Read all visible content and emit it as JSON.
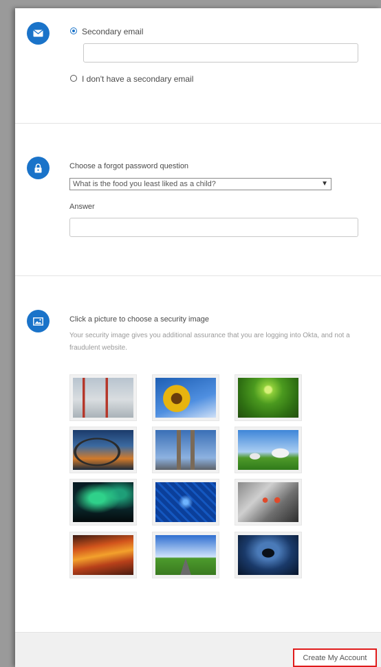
{
  "email": {
    "secondary_label": "Secondary email",
    "secondary_value": "",
    "no_secondary_label": "I don't have a secondary email",
    "selected": "secondary"
  },
  "password_question": {
    "label": "Choose a forgot password question",
    "selected_question": "What is the food you least liked as a child?",
    "answer_label": "Answer",
    "answer_value": ""
  },
  "security_image": {
    "title": "Click a picture to choose a security image",
    "description": "Your security image gives you additional assurance that you are logging into Okta, and not a fraudulent website.",
    "images": [
      {
        "name": "golden-gate-bridge-image",
        "subject": "bridge in fog"
      },
      {
        "name": "sunflower-image",
        "subject": "sunflower"
      },
      {
        "name": "succulent-plant-image",
        "subject": "green succulent"
      },
      {
        "name": "harbour-bridge-image",
        "subject": "harbour bridge at dusk"
      },
      {
        "name": "brooklyn-bridge-image",
        "subject": "suspension bridge"
      },
      {
        "name": "goats-image",
        "subject": "goats in field"
      },
      {
        "name": "aurora-image",
        "subject": "northern lights"
      },
      {
        "name": "circuit-board-image",
        "subject": "blue circuit"
      },
      {
        "name": "robot-image",
        "subject": "robot"
      },
      {
        "name": "sunset-clouds-image",
        "subject": "orange sunset clouds"
      },
      {
        "name": "road-image",
        "subject": "road under blue sky"
      },
      {
        "name": "manta-ray-image",
        "subject": "manta ray"
      }
    ]
  },
  "footer": {
    "create_label": "Create My Account"
  },
  "colors": {
    "accent": "#1a73c9",
    "highlight": "#e01a1a"
  },
  "icons": {
    "email": "envelope-icon",
    "lock": "lock-icon",
    "image": "image-icon"
  }
}
